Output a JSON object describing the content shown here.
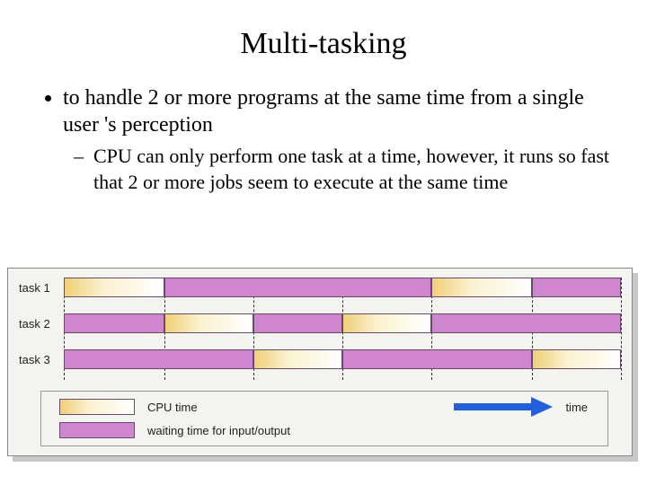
{
  "title": "Multi-tasking",
  "bullet_main": "to handle 2 or more programs at the same time from a single user 's perception",
  "bullet_sub": "CPU can only perform one task at a time, however, it runs so fast that 2 or more jobs seem to execute at the same time",
  "tracks": {
    "labels": [
      "task 1",
      "task 2",
      "task 3"
    ]
  },
  "legend": {
    "cpu": "CPU time",
    "wait": "waiting time for input/output",
    "time": "time"
  },
  "chart_data": {
    "type": "bar",
    "description": "Gantt-style timeline showing interleaved CPU vs waiting intervals for three tasks over a normalized 0-100 time axis. Dashed vertical guides at interval boundaries.",
    "categories": [
      "task 1",
      "task 2",
      "task 3"
    ],
    "x_range": [
      0,
      100
    ],
    "guide_lines": [
      0,
      18,
      34,
      50,
      66,
      84,
      100
    ],
    "series": [
      {
        "name": "task 1",
        "segments": [
          {
            "kind": "cpu",
            "start": 0,
            "end": 18
          },
          {
            "kind": "wait",
            "start": 18,
            "end": 66
          },
          {
            "kind": "cpu",
            "start": 66,
            "end": 84
          },
          {
            "kind": "wait",
            "start": 84,
            "end": 100
          }
        ]
      },
      {
        "name": "task 2",
        "segments": [
          {
            "kind": "wait",
            "start": 0,
            "end": 18
          },
          {
            "kind": "cpu",
            "start": 18,
            "end": 34
          },
          {
            "kind": "wait",
            "start": 34,
            "end": 50
          },
          {
            "kind": "cpu",
            "start": 50,
            "end": 66
          },
          {
            "kind": "wait",
            "start": 66,
            "end": 100
          }
        ]
      },
      {
        "name": "task 3",
        "segments": [
          {
            "kind": "wait",
            "start": 0,
            "end": 34
          },
          {
            "kind": "cpu",
            "start": 34,
            "end": 50
          },
          {
            "kind": "wait",
            "start": 50,
            "end": 84
          },
          {
            "kind": "cpu",
            "start": 84,
            "end": 100
          }
        ]
      }
    ],
    "legend": {
      "cpu": "CPU time",
      "wait": "waiting time for input/output",
      "axis": "time"
    }
  }
}
